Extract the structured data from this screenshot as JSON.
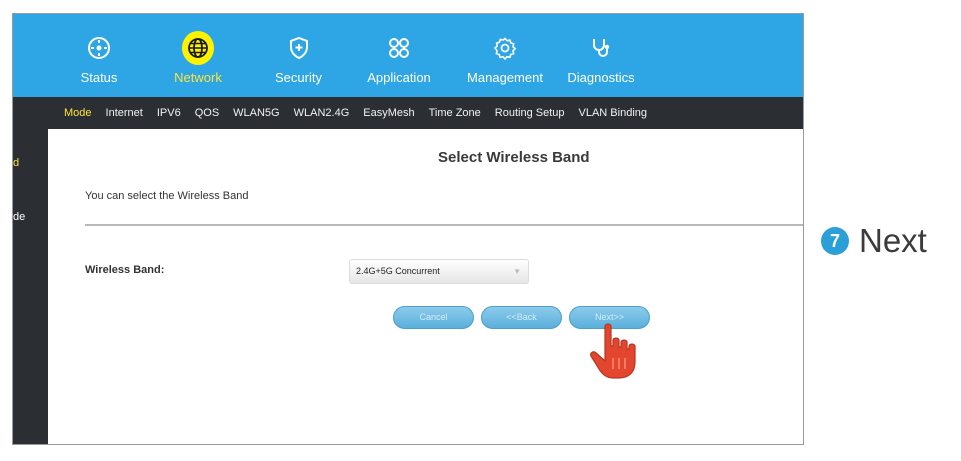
{
  "nav": {
    "items": [
      {
        "label": "Status",
        "icon": "status-icon"
      },
      {
        "label": "Network",
        "icon": "globe-icon",
        "active": true
      },
      {
        "label": "Security",
        "icon": "shield-plus-icon"
      },
      {
        "label": "Application",
        "icon": "apps-icon"
      },
      {
        "label": "Management",
        "icon": "gear-icon"
      },
      {
        "label": "Diagnostics",
        "icon": "stethoscope-icon"
      }
    ]
  },
  "subnav": {
    "items": [
      "Mode",
      "Internet",
      "IPV6",
      "QOS",
      "WLAN5G",
      "WLAN2.4G",
      "EasyMesh",
      "Time Zone",
      "Routing Setup",
      "VLAN Binding"
    ],
    "active": "Mode"
  },
  "sidebar": {
    "items": [
      {
        "label": "d",
        "active": true
      },
      {
        "label": "de",
        "active": false
      }
    ]
  },
  "page": {
    "title": "Select Wireless Band",
    "description": "You can select the Wireless Band",
    "band_label": "Wireless Band:",
    "band_value": "2.4G+5G Concurrent"
  },
  "buttons": {
    "cancel": "Cancel",
    "back": "<<Back",
    "next": "Next>>"
  },
  "step": {
    "number": "7",
    "text": "Next"
  },
  "colors": {
    "topbar": "#2ea6e6",
    "accent": "#ffe33a",
    "subnav": "#2b2f33",
    "button": "#5aafdc",
    "step": "#2a9fd8",
    "pointer": "#e2462f"
  }
}
